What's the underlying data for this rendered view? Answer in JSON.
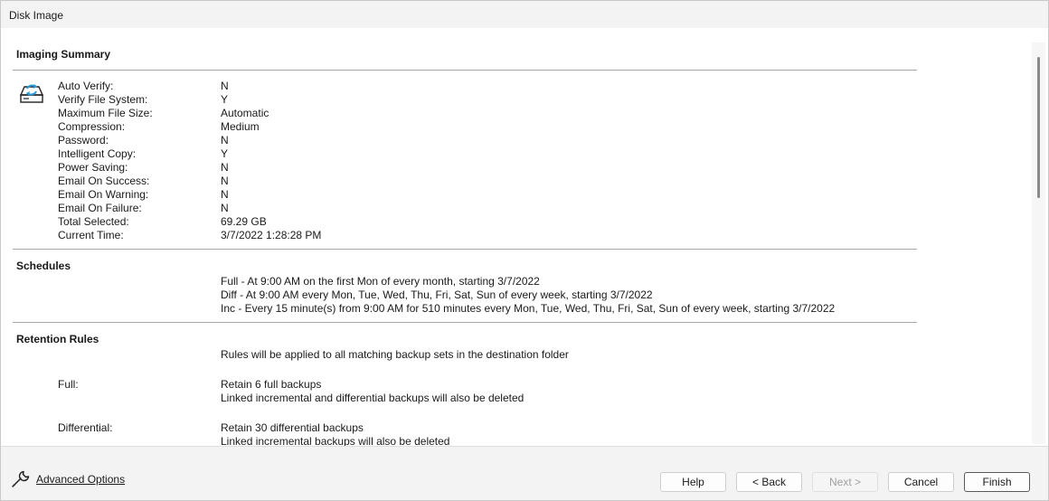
{
  "window": {
    "title": "Disk Image"
  },
  "summary": {
    "heading": "Imaging Summary",
    "icon": "disk-refresh-icon",
    "rows": [
      {
        "label": "Auto Verify:",
        "value": "N"
      },
      {
        "label": "Verify File System:",
        "value": "Y"
      },
      {
        "label": "Maximum File Size:",
        "value": "Automatic"
      },
      {
        "label": "Compression:",
        "value": "Medium"
      },
      {
        "label": "Password:",
        "value": "N"
      },
      {
        "label": "Intelligent Copy:",
        "value": "Y"
      },
      {
        "label": "Power Saving:",
        "value": "N"
      },
      {
        "label": "Email On Success:",
        "value": "N"
      },
      {
        "label": "Email On Warning:",
        "value": "N"
      },
      {
        "label": "Email On Failure:",
        "value": "N"
      },
      {
        "label": "Total Selected:",
        "value": "69.29 GB"
      },
      {
        "label": "Current Time:",
        "value": "3/7/2022 1:28:28 PM"
      }
    ]
  },
  "schedules": {
    "heading": "Schedules",
    "lines": [
      "Full - At 9:00 AM on the first Mon of every month, starting 3/7/2022",
      "Diff - At 9:00 AM every Mon, Tue, Wed, Thu, Fri, Sat, Sun of every week, starting 3/7/2022",
      "Inc - Every 15 minute(s) from 9:00 AM for 510 minutes every Mon, Tue, Wed, Thu, Fri, Sat, Sun of every week, starting 3/7/2022"
    ]
  },
  "retention": {
    "heading": "Retention Rules",
    "intro": "Rules will be applied to all matching backup sets in the destination folder",
    "full": {
      "label": "Full:",
      "lines": [
        "Retain 6 full backups",
        "Linked incremental and differential backups will also be deleted"
      ]
    },
    "differential": {
      "label": "Differential:",
      "lines": [
        "Retain 30 differential backups",
        "Linked incremental backups will also be deleted"
      ]
    }
  },
  "footer": {
    "advanced_icon": "wrench-icon",
    "advanced_label": "Advanced Options",
    "help": "Help",
    "back": "< Back",
    "next": "Next >",
    "cancel": "Cancel",
    "finish": "Finish"
  },
  "colors": {
    "icon_accent": "#2a9bd8",
    "divider": "#a8a8a8"
  }
}
